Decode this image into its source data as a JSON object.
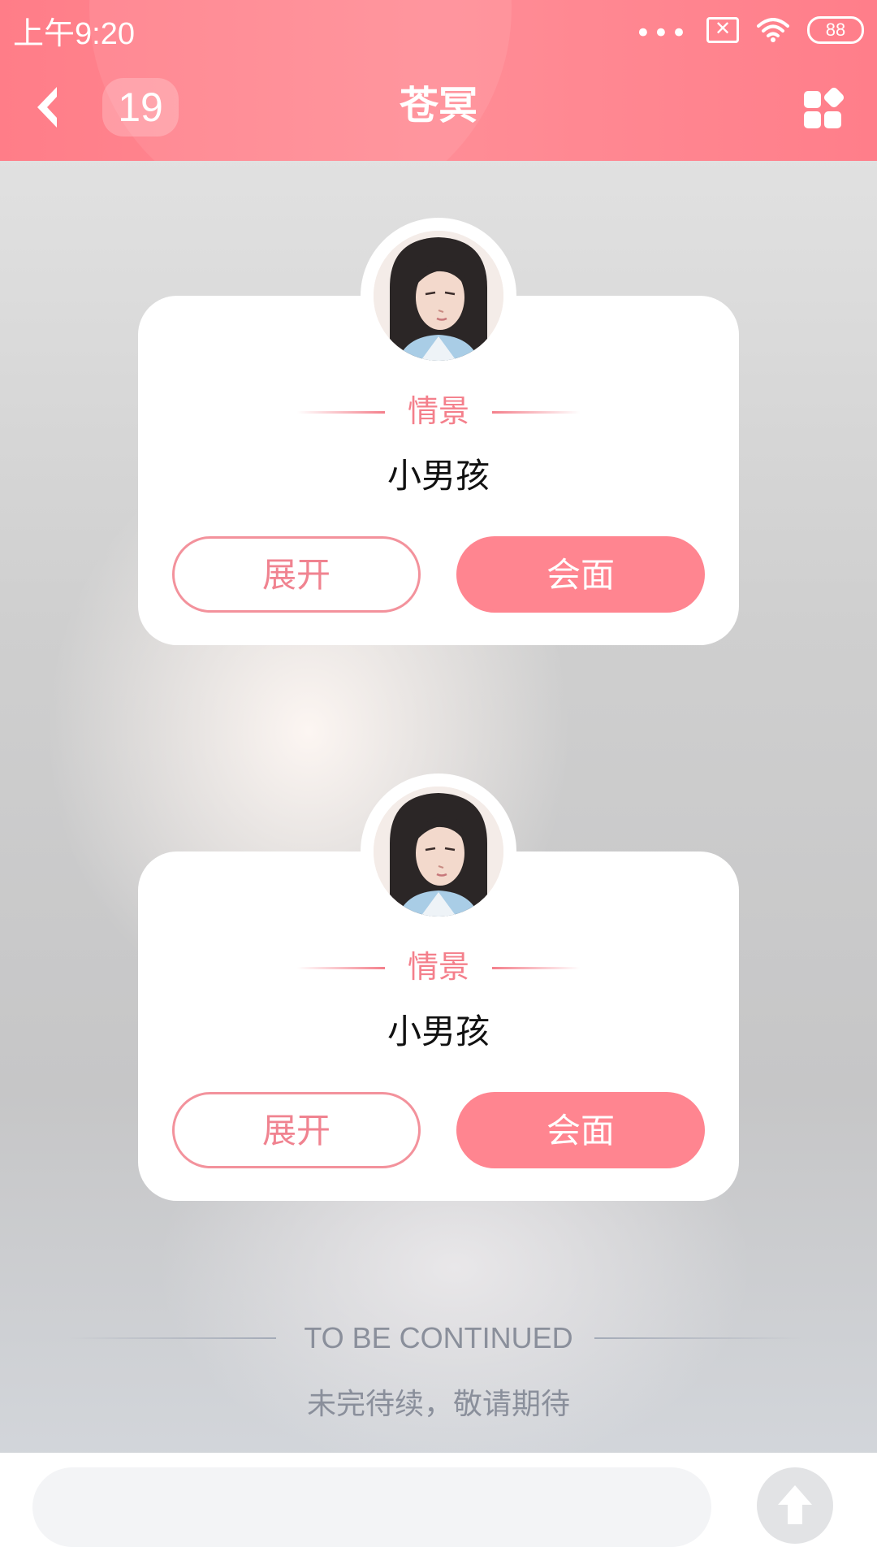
{
  "status_bar": {
    "time": "上午9:20",
    "dots": "•••",
    "sim_icon": "✕",
    "battery": "88"
  },
  "header": {
    "count": "19",
    "title": "苍冥",
    "back_icon": "chevron-left-icon",
    "menu_icon": "grid-icon"
  },
  "scenes": [
    {
      "tag": "情景",
      "name": "小男孩",
      "expand_label": "展开",
      "meet_label": "会面"
    },
    {
      "tag": "情景",
      "name": "小男孩",
      "expand_label": "展开",
      "meet_label": "会面"
    }
  ],
  "notice": {
    "title": "TO BE CONTINUED",
    "subtitle": "未完待续，敬请期待"
  },
  "input": {
    "placeholder": "",
    "send_icon": "up-arrow-icon"
  },
  "colors": {
    "header": "#ff8590",
    "accent": "#f47f8b",
    "meet_button": "#ff8590"
  }
}
